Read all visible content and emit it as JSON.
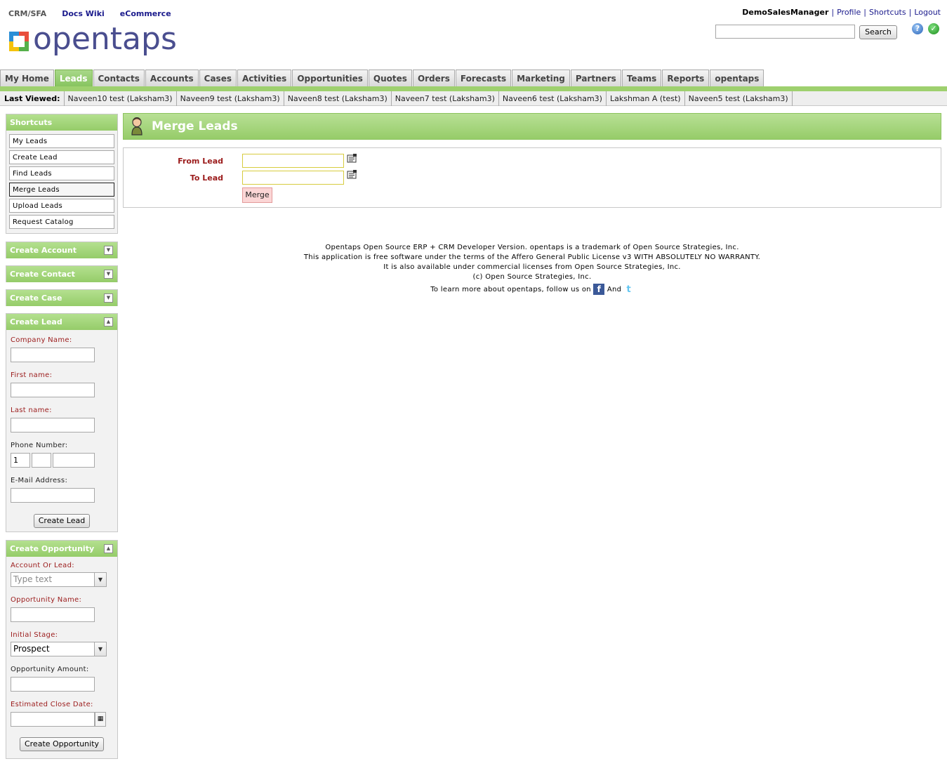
{
  "header": {
    "app_links": [
      "CRM/SFA",
      "Docs Wiki",
      "eCommerce"
    ],
    "logo_text": "opentaps",
    "user": "DemoSalesManager",
    "user_links": [
      "Profile",
      "Shortcuts",
      "Logout"
    ],
    "search_button": "Search",
    "search_value": ""
  },
  "tabs": [
    "My Home",
    "Leads",
    "Contacts",
    "Accounts",
    "Cases",
    "Activities",
    "Opportunities",
    "Quotes",
    "Orders",
    "Forecasts",
    "Marketing",
    "Partners",
    "Teams",
    "Reports",
    "opentaps"
  ],
  "active_tab": "Leads",
  "last_viewed": {
    "label": "Last Viewed:",
    "items": [
      "Naveen10 test (Laksham3)",
      "Naveen9 test (Laksham3)",
      "Naveen8 test (Laksham3)",
      "Naveen7 test (Laksham3)",
      "Naveen6 test (Laksham3)",
      "Lakshman A (test)",
      "Naveen5 test (Laksham3)"
    ]
  },
  "sidebar": {
    "shortcuts_title": "Shortcuts",
    "shortcuts": [
      "My Leads",
      "Create Lead",
      "Find Leads",
      "Merge Leads",
      "Upload Leads",
      "Request Catalog"
    ],
    "selected_shortcut": "Merge Leads",
    "collapsed_sections": [
      "Create Account",
      "Create Contact",
      "Create Case"
    ],
    "create_lead": {
      "title": "Create Lead",
      "company_label": "Company Name:",
      "first_name_label": "First name:",
      "last_name_label": "Last name:",
      "phone_label": "Phone Number:",
      "phone_country_code": "1",
      "email_label": "E-Mail Address:",
      "button": "Create Lead"
    },
    "create_opportunity": {
      "title": "Create Opportunity",
      "account_label": "Account Or Lead:",
      "account_placeholder": "Type text",
      "name_label": "Opportunity Name:",
      "stage_label": "Initial Stage:",
      "stage_value": "Prospect",
      "amount_label": "Opportunity Amount:",
      "close_date_label": "Estimated Close Date:",
      "button": "Create Opportunity"
    }
  },
  "main": {
    "title": "Merge Leads",
    "from_label": "From Lead",
    "to_label": "To Lead",
    "from_value": "",
    "to_value": "",
    "merge_button": "Merge"
  },
  "footer": {
    "line1": "Opentaps Open Source ERP + CRM Developer Version. opentaps is a trademark of Open Source Strategies, Inc.",
    "line2": "This application is free software under the terms of the Affero General Public License v3 WITH ABSOLUTELY NO WARRANTY.",
    "line3": "It is also available under commercial licenses from Open Source Strategies, Inc.",
    "line4": "(c) Open Source Strategies, Inc.",
    "follow_text": "To learn more about opentaps, follow us on",
    "and_text": "And"
  },
  "colors": {
    "accent_green": "#96cc69",
    "required_label": "#9b1b1b",
    "link_blue": "#1a1a8c"
  }
}
